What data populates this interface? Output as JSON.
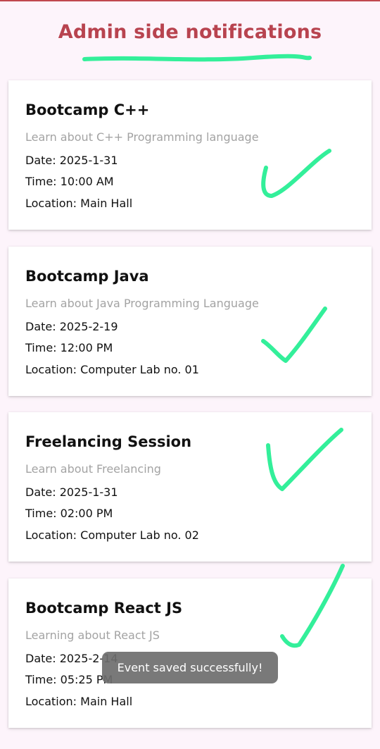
{
  "header": {
    "title": "Admin side notifications",
    "accent_color": "#b8434f",
    "underline_color": "#33ef9a"
  },
  "notifications": [
    {
      "title": "Bootcamp C++",
      "description": "Learn about C++ Programming language",
      "date": "Date: 2025-1-31",
      "time": "Time: 10:00 AM",
      "location": "Location: Main Hall",
      "marked": "check-icon"
    },
    {
      "title": "Bootcamp Java",
      "description": "Learn about Java Programming Language",
      "date": "Date: 2025-2-19",
      "time": "Time: 12:00 PM",
      "location": "Location: Computer Lab no. 01",
      "marked": "check-icon"
    },
    {
      "title": "Freelancing Session",
      "description": "Learn about Freelancing",
      "date": "Date: 2025-1-31",
      "time": "Time: 02:00 PM",
      "location": "Location: Computer Lab no. 02",
      "marked": "check-icon"
    },
    {
      "title": "Bootcamp React JS",
      "description": "Learning about React JS",
      "date": "Date: 2025-2-14",
      "time": "Time: 05:25 PM",
      "location": "Location: Main Hall",
      "marked": "check-icon"
    }
  ],
  "toast": {
    "message": "Event saved successfully!"
  },
  "colors": {
    "background": "#fdf4fb",
    "card": "#ffffff",
    "check_stroke": "#33ef9a",
    "muted_text": "#a3a3a3"
  }
}
